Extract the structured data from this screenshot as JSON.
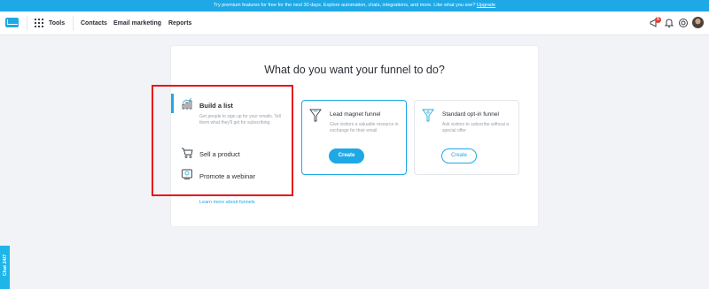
{
  "promo": {
    "text": "Try premium features for free for the next 30 days. Explore automation, chats, integrations, and more. Like what you see?",
    "link": "Upgrade"
  },
  "topnav": {
    "tools": "Tools",
    "items": [
      "Contacts",
      "Email marketing",
      "Reports"
    ],
    "notifications_count": "5"
  },
  "main": {
    "heading": "What do you want your funnel to do?",
    "goals": [
      {
        "label": "Build a list",
        "description": "Get people to sign up for your emails. Tell them what they'll get for subscribing."
      },
      {
        "label": "Sell a product"
      },
      {
        "label": "Promote a webinar"
      }
    ],
    "funnels": [
      {
        "title": "Lead magnet funnel",
        "description": "Give visitors a valuable resource in exchange for their email",
        "button": "Create"
      },
      {
        "title": "Standard opt-in funnel",
        "description": "Ask visitors to subscribe without a special offer",
        "button": "Create"
      }
    ],
    "learn_more": "Learn more about funnels"
  },
  "chat": {
    "label": "Chat 24/7"
  },
  "colors": {
    "accent": "#1fa8e6",
    "highlight": "#e8141c"
  }
}
